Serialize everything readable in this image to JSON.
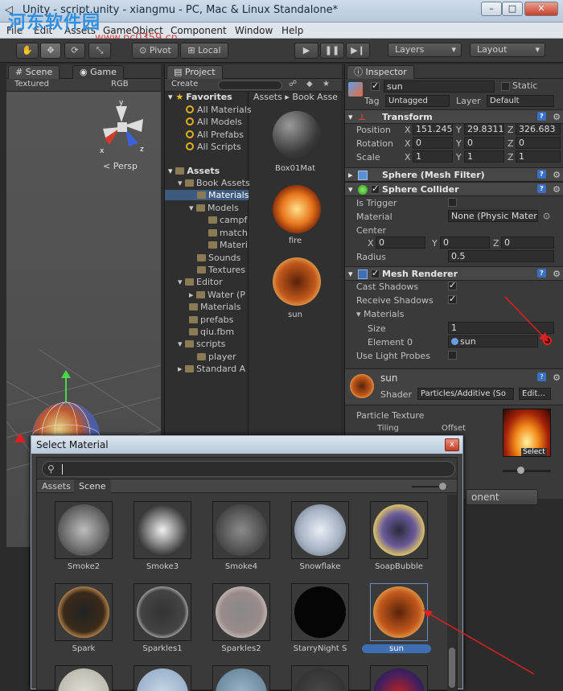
{
  "window": {
    "title": "Unity - script.unity - xiangmu - PC, Mac & Linux Standalone*",
    "min": "–",
    "max": "□",
    "close": "✕"
  },
  "watermark": {
    "text": "河东软件园",
    "url": "www.pc0359.cn"
  },
  "menubar": [
    "File",
    "Edit",
    "Assets",
    "GameObject",
    "Component",
    "Window",
    "Help"
  ],
  "toolbar": {
    "pivot": "Pivot",
    "local": "Local",
    "layers": "Layers",
    "layout": "Layout"
  },
  "scene": {
    "tab_scene": "Scene",
    "tab_game": "Game",
    "shading": "Textured",
    "rgb": "RGB",
    "persp": "Persp"
  },
  "project": {
    "tab": "Project",
    "create": "Create",
    "breadcrumb": "Assets ▸ Book Asse",
    "tree": {
      "favorites": "Favorites",
      "fav_items": [
        "All Materials",
        "All Models",
        "All Prefabs",
        "All Scripts"
      ],
      "assets": "Assets",
      "items": [
        "Book Assets",
        "Materials",
        "Models",
        "campf",
        "match",
        "Materi",
        "Sounds",
        "Textures",
        "Editor",
        "Water (P",
        "Materials",
        "prefabs",
        "qiu.fbm",
        "scripts",
        "player",
        "Standard A"
      ]
    },
    "grid": [
      "Box01Mat",
      "fire",
      "sun"
    ]
  },
  "inspector": {
    "tab": "Inspector",
    "object": "sun",
    "static": "Static",
    "tag_label": "Tag",
    "tag": "Untagged",
    "layer_label": "Layer",
    "layer": "Default",
    "transform": "Transform",
    "position": {
      "label": "Position",
      "x": "151.245",
      "y": "29.8311",
      "z": "326.683"
    },
    "rotation": {
      "label": "Rotation",
      "x": "0",
      "y": "0",
      "z": "0"
    },
    "scale": {
      "label": "Scale",
      "x": "1",
      "y": "1",
      "z": "1"
    },
    "axes": {
      "x": "X",
      "y": "Y",
      "z": "Z"
    },
    "mesh_filter": "Sphere (Mesh Filter)",
    "collider": "Sphere Collider",
    "is_trigger": "Is Trigger",
    "material_label": "Material",
    "material_value": "None (Physic Materi",
    "center_label": "Center",
    "center": {
      "x": "0",
      "y": "0",
      "z": "0"
    },
    "radius_label": "Radius",
    "radius": "0.5",
    "renderer": "Mesh Renderer",
    "cast_shadows": "Cast Shadows",
    "receive_shadows": "Receive Shadows",
    "materials": "Materials",
    "size_label": "Size",
    "size": "1",
    "element0_label": "Element 0",
    "element0": "sun",
    "light_probes": "Use Light Probes",
    "mat_name": "sun",
    "shader_label": "Shader",
    "shader": "Particles/Additive (So",
    "edit": "Edit...",
    "particle_texture": "Particle Texture",
    "tiling": "Tiling",
    "offset": "Offset",
    "select": "Select",
    "add_component": "onent"
  },
  "dialog": {
    "title": "Select Material",
    "close": "x",
    "tab_assets": "Assets",
    "tab_scene": "Scene",
    "items": [
      "Smoke2",
      "Smoke3",
      "Smoke4",
      "Snowflake",
      "SoapBubble",
      "Spark",
      "Sparkles1",
      "Sparkles2",
      "StarryNight S",
      "sun"
    ]
  }
}
